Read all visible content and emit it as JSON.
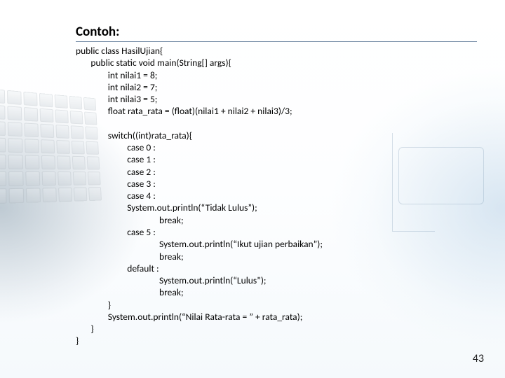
{
  "title": "Contoh:",
  "code_lines": [
    "public class HasilUjian{",
    "       public static void main(String[] args){",
    "               int nilai1 = 8;",
    "               int nilai2 = 7;",
    "               int nilai3 = 5;",
    "               float rata_rata = (float)(nilai1 + nilai2 + nilai3)/3;",
    "",
    "               switch((int)rata_rata){",
    "                        case 0 :",
    "                        case 1 :",
    "                        case 2 :",
    "                        case 3 :",
    "                        case 4 :",
    "                        System.out.println(“Tidak Lulus”);",
    "                                       break;",
    "                        case 5 :",
    "                                       System.out.println(“Ikut ujian perbaikan”);",
    "                                       break;",
    "                        default :",
    "                                       System.out.println(“Lulus”);",
    "                                       break;",
    "               }",
    "               System.out.println(“Nilai Rata-rata = ” + rata_rata);",
    "       }",
    "}"
  ],
  "page_number": "43"
}
